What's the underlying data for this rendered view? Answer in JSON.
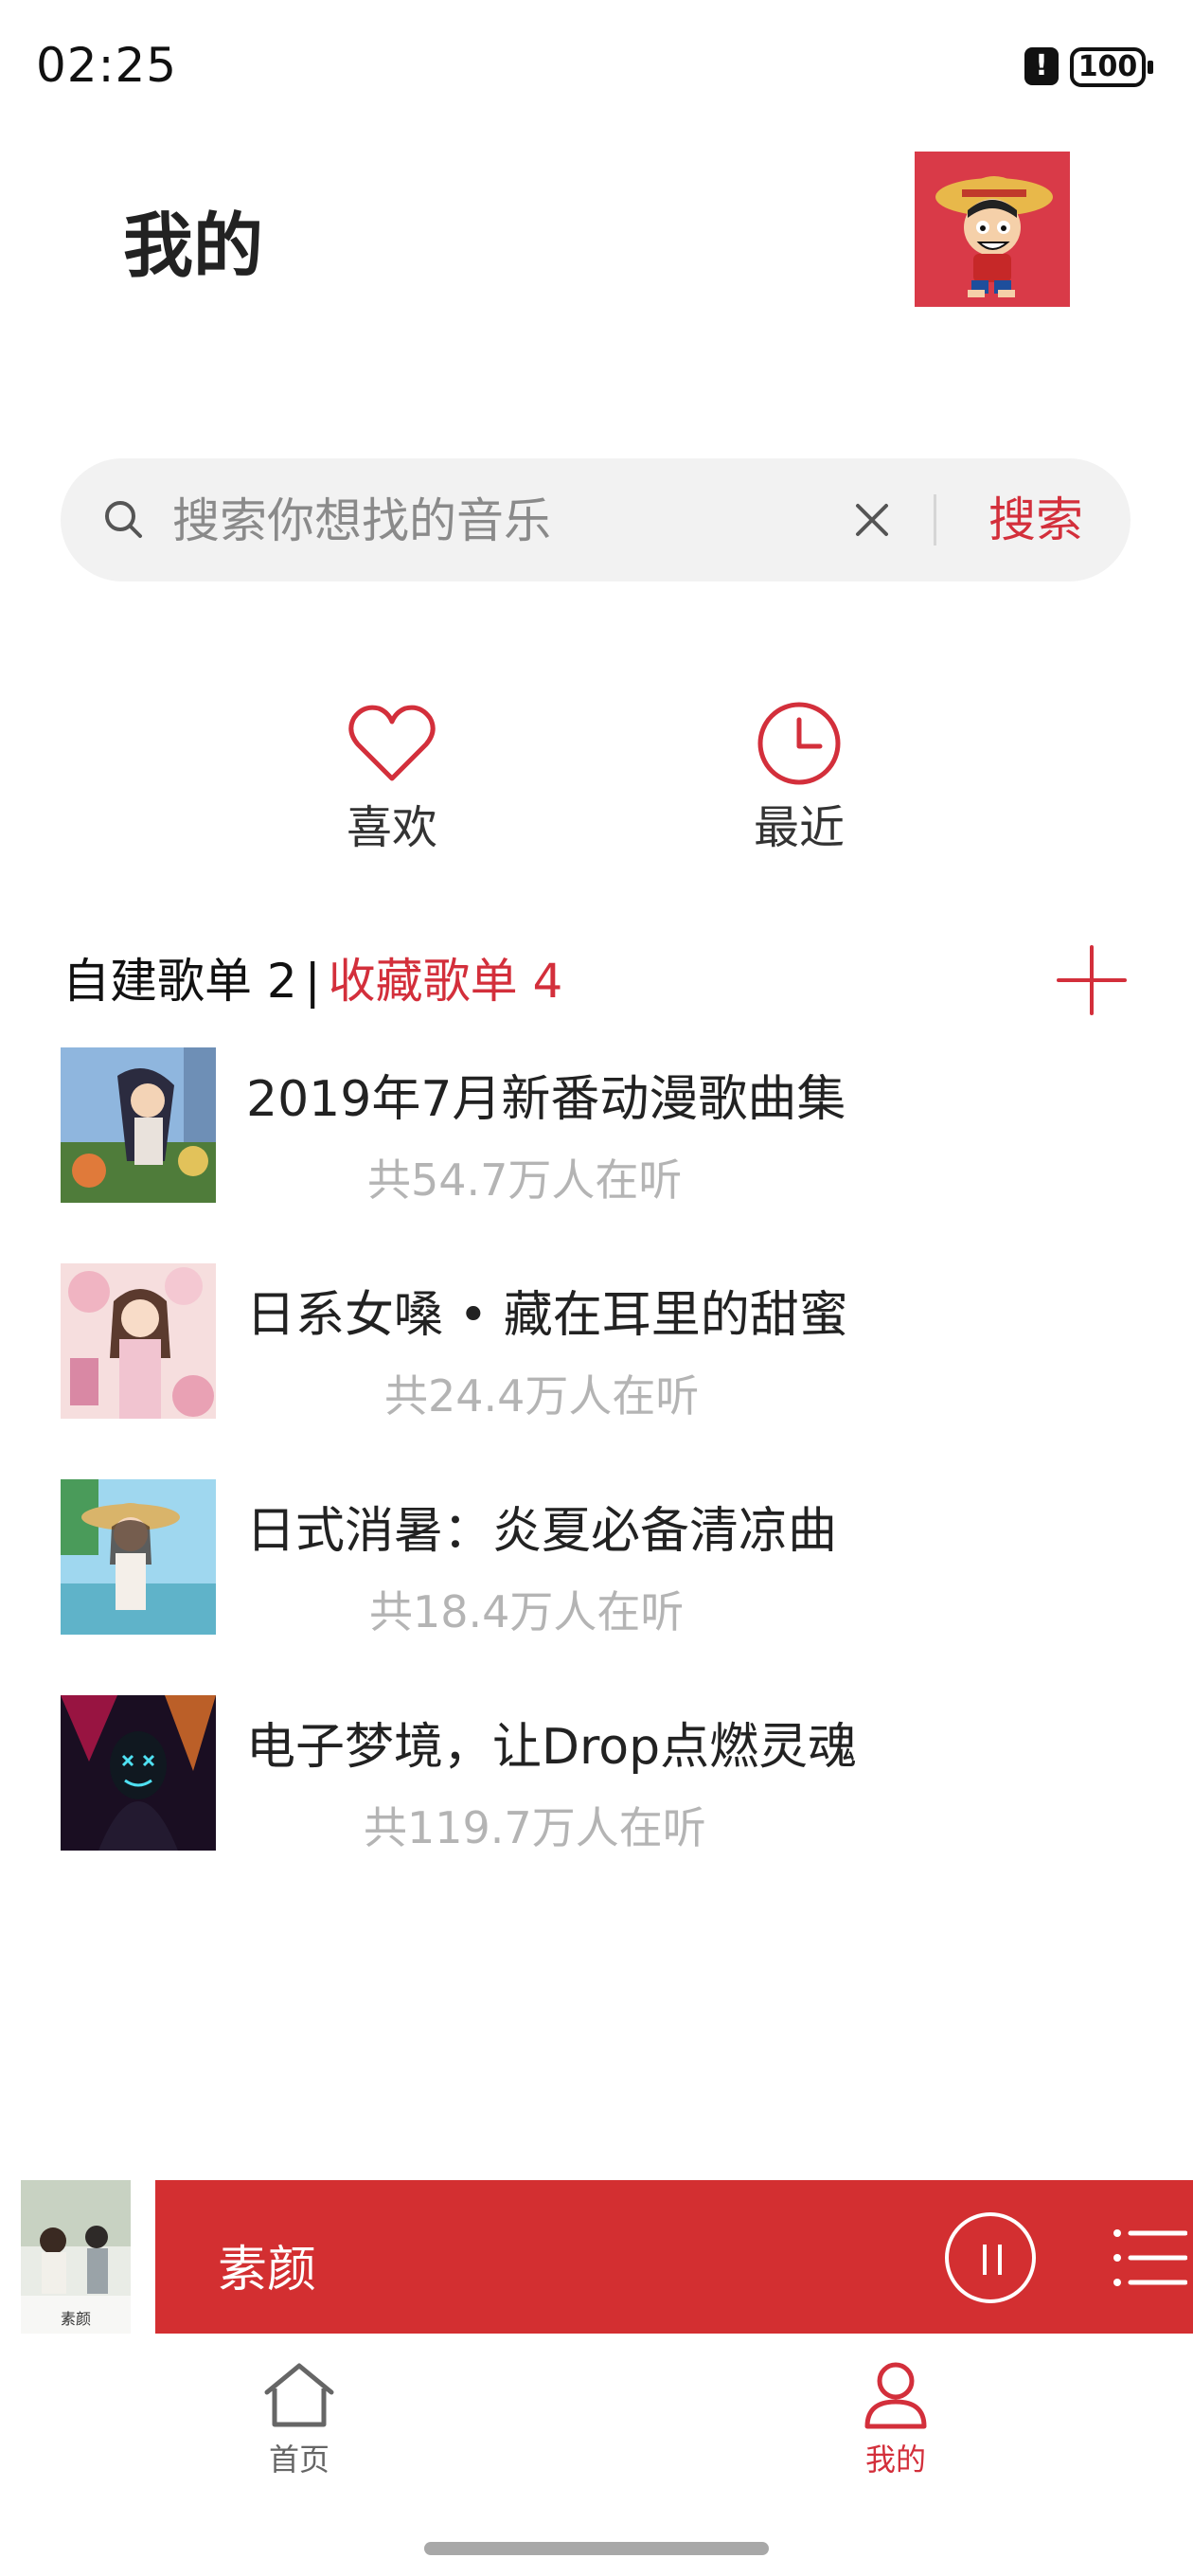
{
  "status_bar": {
    "time": "02:25",
    "battery": "100"
  },
  "header": {
    "title": "我的"
  },
  "search": {
    "placeholder": "搜索你想找的音乐",
    "button_label": "搜索"
  },
  "quick_actions": [
    {
      "label": "喜欢",
      "icon": "heart-icon"
    },
    {
      "label": "最近",
      "icon": "clock-icon"
    }
  ],
  "playlist_tabs": {
    "own_label": "自建歌单",
    "own_count": "2",
    "separator": "|",
    "favorite_label": "收藏歌单",
    "favorite_count": "4"
  },
  "playlists": [
    {
      "title": "2019年7月新番动漫歌曲集",
      "listeners": "共54.7万人在听"
    },
    {
      "title": "日系女嗓 • 藏在耳里的甜蜜",
      "listeners": "共24.4万人在听"
    },
    {
      "title": "日式消暑：炎夏必备清凉曲",
      "listeners": "共18.4万人在听"
    },
    {
      "title": "电子梦境，让Drop点燃灵魂",
      "listeners": "共119.7万人在听"
    }
  ],
  "mini_player": {
    "song_title": "素颜",
    "cover_text": "素颜"
  },
  "bottom_nav": [
    {
      "label": "首页",
      "icon": "home-icon",
      "active": false
    },
    {
      "label": "我的",
      "icon": "user-icon",
      "active": true
    }
  ],
  "colors": {
    "accent": "#d32f3b",
    "muted_text": "#b4b4b4",
    "search_bg": "#f2f2f2"
  }
}
